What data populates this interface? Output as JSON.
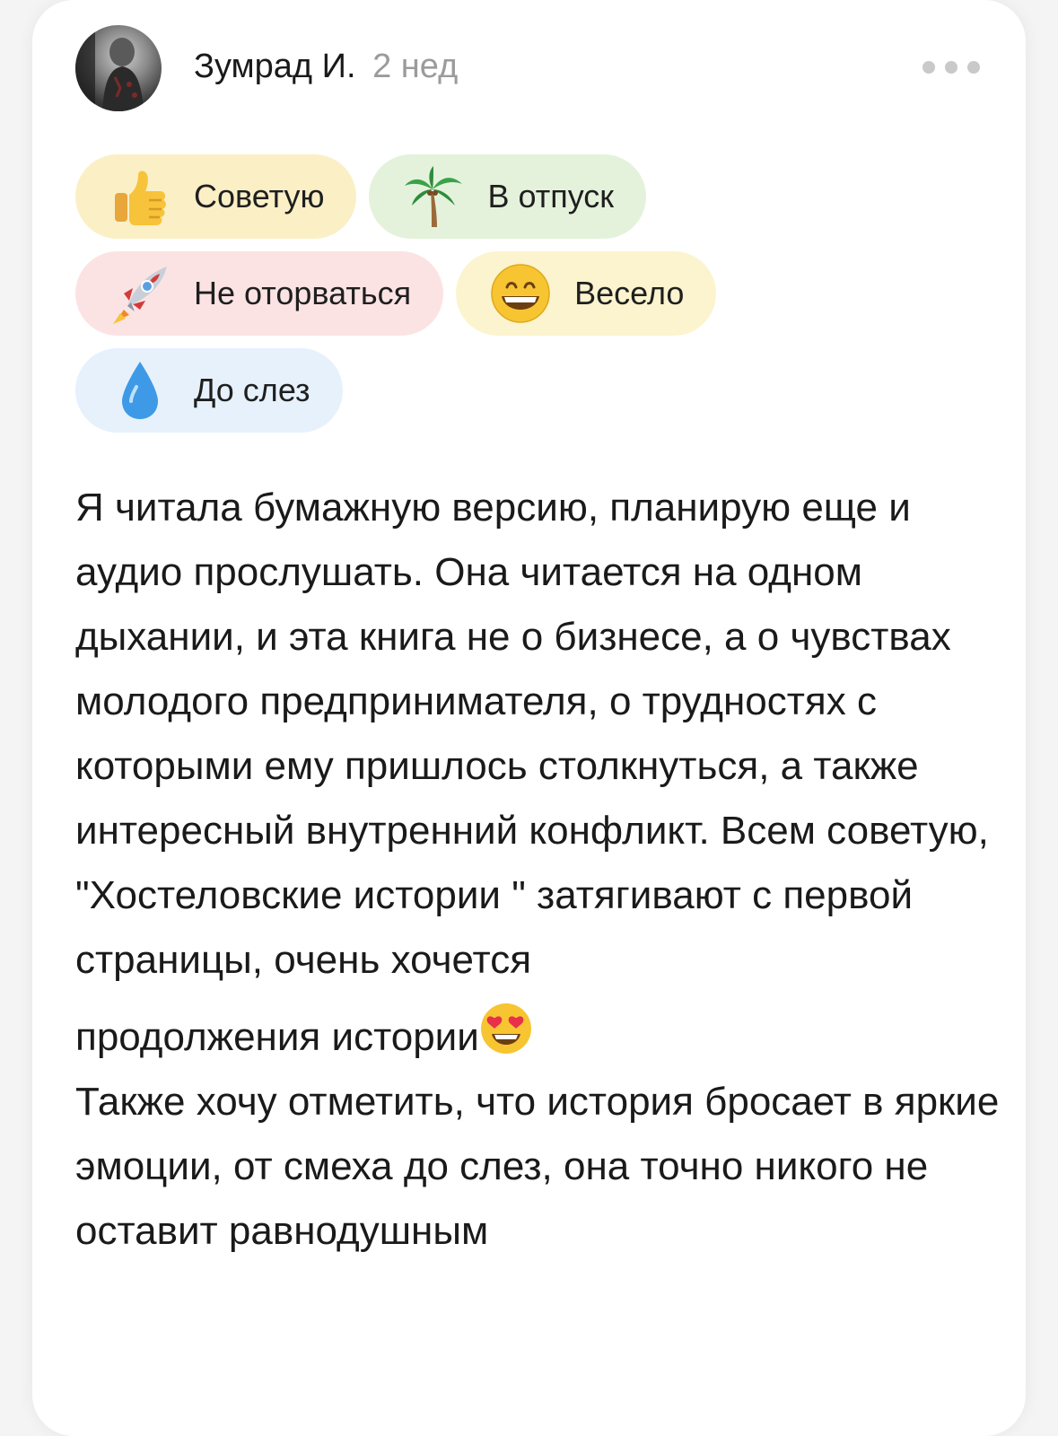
{
  "review_card": {
    "author": {
      "name": "Зумрад И.",
      "time_ago": "2 нед"
    },
    "tags": [
      {
        "label": "Советую",
        "icon": "thumbs-up-icon",
        "bg": "#fbefc6"
      },
      {
        "label": "В отпуск",
        "icon": "palm-tree-icon",
        "bg": "#e4f2dc"
      },
      {
        "label": "Не оторваться",
        "icon": "rocket-icon",
        "bg": "#fbe3e4"
      },
      {
        "label": "Весело",
        "icon": "grinning-face-icon",
        "bg": "#fbf4cf"
      },
      {
        "label": "До слез",
        "icon": "droplet-icon",
        "bg": "#e6f1fb"
      }
    ],
    "text": {
      "paragraph_1": "Я читала бумажную версию, планирую еще и аудио прослушать. Она читается на одном дыхании, и эта книга не о бизнесе, а о чувствах молодого предпринимателя, о трудностях с которыми ему пришлось столкнуться, а также интересный внутренний конфликт. Всем советую, \"Хостеловские истории \" затягивают с первой страницы, очень хочется",
      "paragraph_2": "продолжения истории",
      "paragraph_2_emoji": "heart-eyes-icon",
      "paragraph_3": "Также хочу отметить, что история бросает в яркие эмоции, от смеха до слез, она точно никого не оставит равнодушным"
    }
  }
}
